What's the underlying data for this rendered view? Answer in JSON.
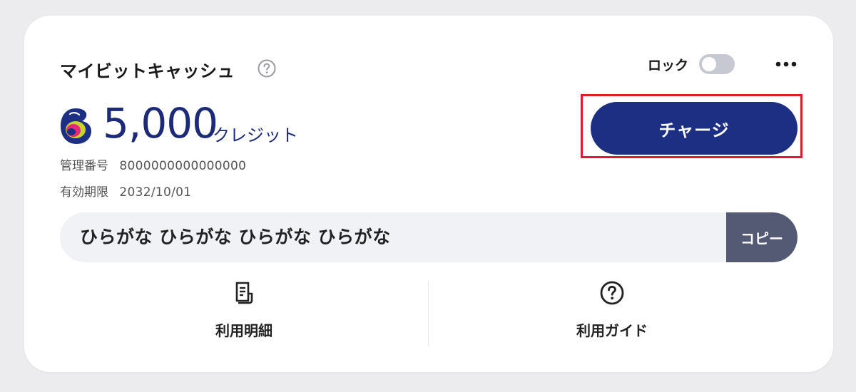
{
  "card": {
    "title": "マイビットキャッシュ",
    "lock_label": "ロック",
    "lock_enabled": false,
    "balance": "5,000",
    "unit": "クレジット",
    "management_number_label": "管理番号",
    "management_number_value": "8000000000000000",
    "expiry_label": "有効期限",
    "expiry_value": "2032/10/01",
    "charge_label": "チャージ",
    "code_value": "ひらがな ひらがな ひらがな ひらがな",
    "copy_label": "コピー",
    "usage_details_label": "利用明細",
    "usage_guide_label": "利用ガイド"
  },
  "icons": {
    "help": "question-circle-icon",
    "more": "ellipsis-icon",
    "logo": "bitcash-logo-icon",
    "details": "receipt-icon",
    "guide": "question-circle-icon"
  },
  "colors": {
    "brand_navy": "#1c2f82",
    "highlight_red": "#e01b2c",
    "copy_button": "#545a73",
    "field_background": "#f1f2f5",
    "toggle_off": "#c6c9d1"
  }
}
